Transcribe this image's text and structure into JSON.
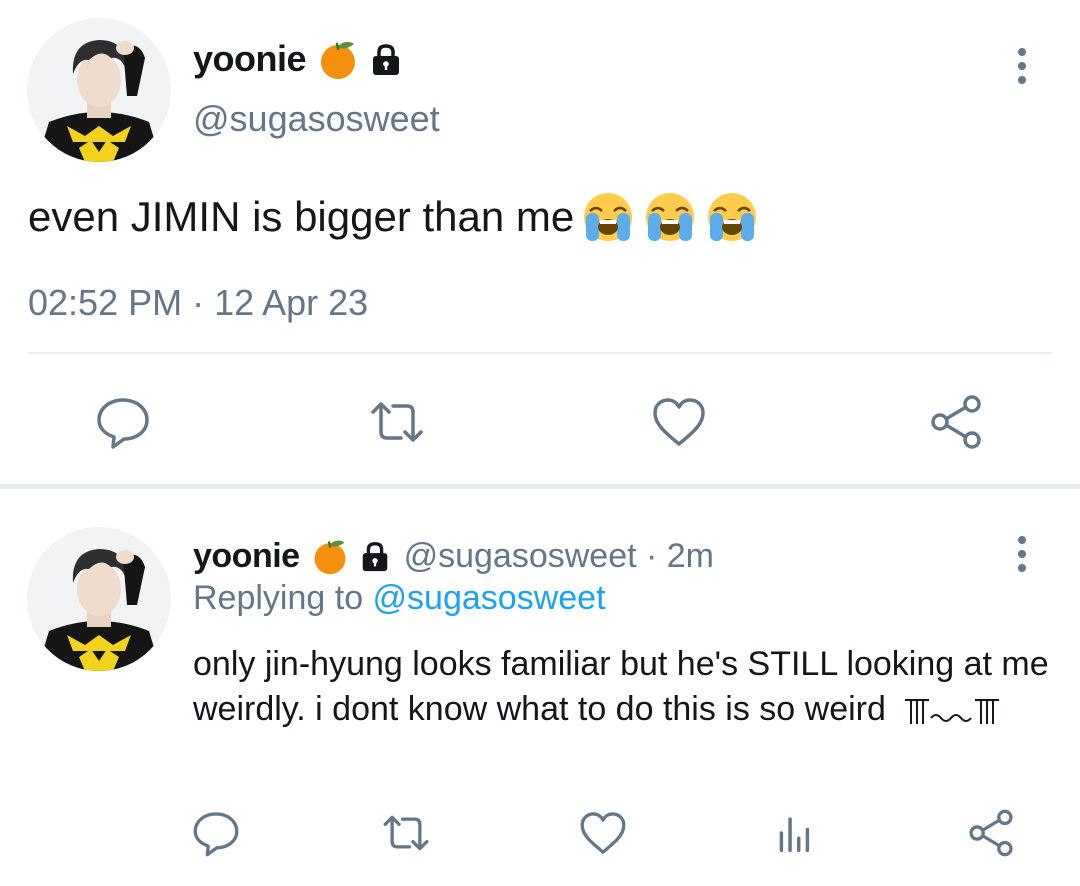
{
  "main_tweet": {
    "display_name": "yoonie",
    "handle": "@sugasosweet",
    "text": "even JIMIN is bigger than me",
    "emoji_count": 3,
    "timestamp": "02:52 PM · 12 Apr 23",
    "icons": [
      "orange-emoji-icon",
      "lock-icon",
      "more-options-icon",
      "loudly-crying-emoji-icon"
    ],
    "actions": [
      "reply-icon",
      "retweet-icon",
      "like-icon",
      "share-icon"
    ]
  },
  "reply_tweet": {
    "display_name": "yoonie",
    "handle_time": "@sugasosweet · 2m",
    "replying_prefix": "Replying to ",
    "replying_handle": "@sugasosweet",
    "text": "only jin-hyung looks familiar but he's STILL looking at me weirdly. i dont know what to do this is so weird",
    "kaomoji": "╥﹏╥",
    "actions": [
      "reply-icon",
      "retweet-icon",
      "like-icon",
      "analytics-icon",
      "share-icon"
    ]
  },
  "colors": {
    "text_primary": "#14171a",
    "text_secondary": "#657786",
    "link": "#1da1f2",
    "divider": "#e6ecf0"
  }
}
